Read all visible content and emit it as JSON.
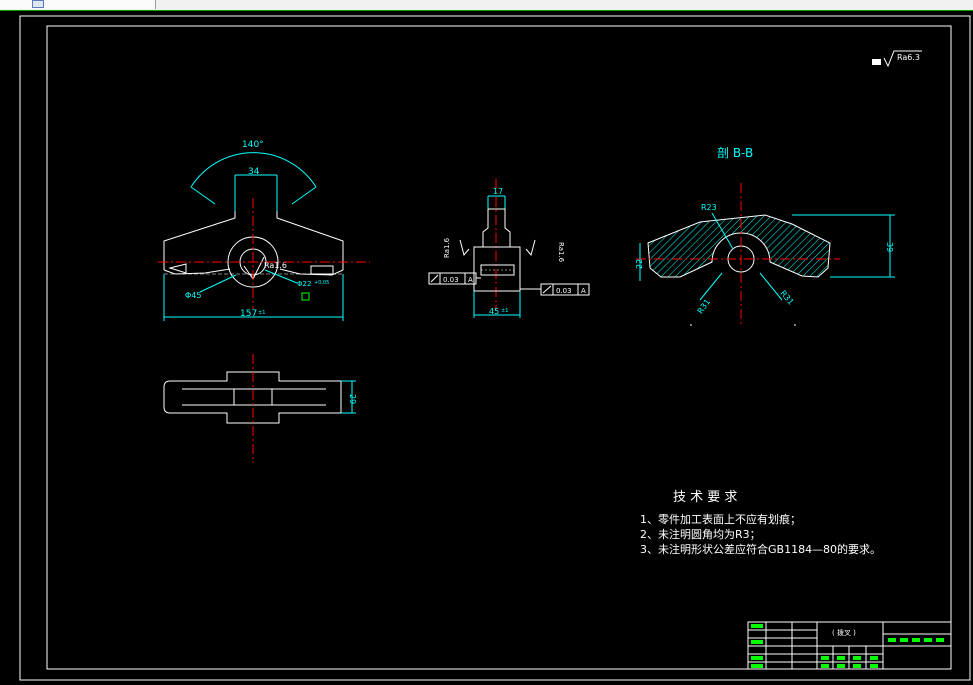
{
  "colors": {
    "background": "#000000",
    "outline": "#ffffff",
    "dimension": "#00ffff",
    "centerline": "#ff0000",
    "hatch": "#00ffff",
    "titleblock": "#00ff00",
    "text": "#ffffff"
  },
  "surface_finish_note": "Ra6.3",
  "views": {
    "front": {
      "angle_dim": "140°",
      "top_width_dim": "34",
      "bore_roughness": "Ra1.6",
      "hub_diameter_dim": "Φ45",
      "bore_diameter_dim": "Φ22",
      "bore_tolerance": "+0.05",
      "overall_length_dim": "157",
      "overall_length_tol": "±1"
    },
    "side": {
      "top_width_dim": "17",
      "left_roughness": "Ra1.6",
      "right_roughness": "Ra1.6",
      "left_tolerance_value": "0.03",
      "left_tolerance_datum": "A",
      "right_tolerance_value": "0.03",
      "right_tolerance_datum": "A",
      "bottom_width_dim": "45",
      "bottom_width_tol": "±1"
    },
    "section": {
      "title": "剖 B-B",
      "bore_radius_dim": "R23",
      "left_thickness_dim": "22",
      "height_dim": "39",
      "left_radius_dim": "R31",
      "right_radius_dim": "R31"
    },
    "top": {
      "thickness_dim": "29"
    }
  },
  "tech_requirements": {
    "heading": "技 术 要 求",
    "items": [
      "1、零件加工表面上不应有划痕；",
      "2、未注明圆角均为R3；",
      "3、未注明形状公差应符合GB1184—80的要求。"
    ]
  },
  "title_block": {
    "material_label": "( 拨叉 )"
  }
}
